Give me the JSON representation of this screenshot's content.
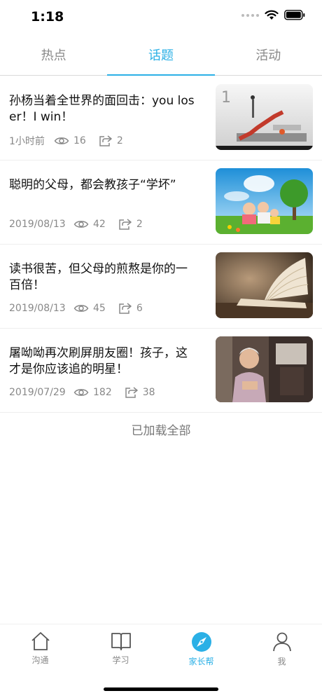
{
  "status_bar": {
    "time": "1:18"
  },
  "tabs": [
    {
      "label": "热点"
    },
    {
      "label": "话题"
    },
    {
      "label": "活动"
    }
  ],
  "active_tab": "话题",
  "articles": [
    {
      "title": "孙杨当着全世界的面回击：you loser！I win！",
      "date": "1小时前",
      "views": "16",
      "shares": "2",
      "thumb": "staircase-illustration"
    },
    {
      "title": "聪明的父母，都会教孩子“学坏”",
      "date": "2019/08/13",
      "views": "42",
      "shares": "2",
      "thumb": "family-on-grass"
    },
    {
      "title": "读书很苦，但父母的煎熬是你的一百倍！",
      "date": "2019/08/13",
      "views": "45",
      "shares": "6",
      "thumb": "open-book"
    },
    {
      "title": "屠呦呦再次刷屏朋友圈！孩子，这才是你应该追的明星！",
      "date": "2019/07/29",
      "views": "182",
      "shares": "38",
      "thumb": "elderly-woman-portrait"
    }
  ],
  "footer_text": "已加载全部",
  "tabbar": [
    {
      "label": "沟通",
      "icon": "home-icon"
    },
    {
      "label": "学习",
      "icon": "book-icon"
    },
    {
      "label": "家长帮",
      "icon": "compass-icon"
    },
    {
      "label": "我",
      "icon": "person-icon"
    }
  ],
  "colors": {
    "accent": "#2bb0e6",
    "text_secondary": "#888888"
  }
}
